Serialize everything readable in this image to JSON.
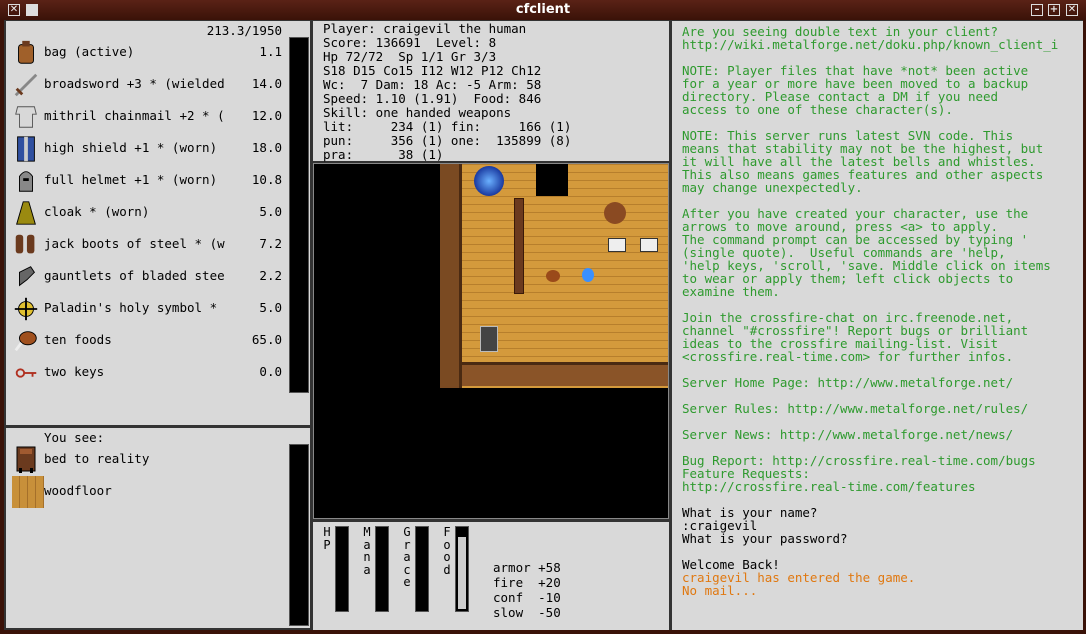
{
  "window": {
    "title": "cfclient"
  },
  "inventory": {
    "weight": "213.3/1950",
    "items": [
      {
        "icon": "bag-icon",
        "name": "bag (active)",
        "weight": "1.1"
      },
      {
        "icon": "sword-icon",
        "name": "broadsword +3 * (wielded",
        "weight": "14.0"
      },
      {
        "icon": "chainmail-icon",
        "name": "mithril chainmail +2 * (",
        "weight": "12.0"
      },
      {
        "icon": "shield-icon",
        "name": "high shield +1 * (worn)",
        "weight": "18.0"
      },
      {
        "icon": "helmet-icon",
        "name": "full helmet +1 * (worn)",
        "weight": "10.8"
      },
      {
        "icon": "cloak-icon",
        "name": "cloak * (worn)",
        "weight": "5.0"
      },
      {
        "icon": "boots-icon",
        "name": "jack boots of steel * (w",
        "weight": "7.2"
      },
      {
        "icon": "gauntlets-icon",
        "name": "gauntlets of bladed stee",
        "weight": "2.2"
      },
      {
        "icon": "holy-symbol-icon",
        "name": "Paladin's holy symbol *",
        "weight": "5.0"
      },
      {
        "icon": "food-icon",
        "name": "ten foods",
        "weight": "65.0"
      },
      {
        "icon": "key-icon",
        "name": "two keys",
        "weight": "0.0"
      }
    ]
  },
  "look": {
    "header": "You see:",
    "items": [
      {
        "icon": "bed-icon",
        "name": "bed to reality"
      },
      {
        "icon": "floor-icon",
        "name": "woodfloor"
      }
    ]
  },
  "stats": {
    "lines": [
      "Player: craigevil the human",
      "Score: 136691  Level: 8",
      "Hp 72/72  Sp 1/1 Gr 3/3",
      "S18 D15 Co15 I12 W12 P12 Ch12",
      "Wc:  7 Dam: 18 Ac: -5 Arm: 58",
      "Speed: 1.10 (1.91)  Food: 846",
      "Skill: one handed weapons",
      "lit:     234 (1) fin:     166 (1)",
      "pun:     356 (1) one:  135899 (8)",
      "pra:      38 (1)"
    ]
  },
  "vitals": {
    "labels": [
      "HP",
      "Mana",
      "Grace",
      "Food"
    ],
    "fill": [
      0,
      0,
      0,
      0.9
    ]
  },
  "resistances": [
    "armor +58",
    "fire  +20",
    "conf  -10",
    "slow  -50"
  ],
  "messages": [
    {
      "t": "Are you seeing double text in your client?",
      "c": "green"
    },
    {
      "t": "http://wiki.metalforge.net/doku.php/known_client_i",
      "c": "green"
    },
    {
      "t": "",
      "c": "green"
    },
    {
      "t": "NOTE: Player files that have *not* been active",
      "c": "green"
    },
    {
      "t": "for a year or more have been moved to a backup",
      "c": "green"
    },
    {
      "t": "directory. Please contact a DM if you need",
      "c": "green"
    },
    {
      "t": "access to one of these character(s).",
      "c": "green"
    },
    {
      "t": "",
      "c": "green"
    },
    {
      "t": "NOTE: This server runs latest SVN code. This",
      "c": "green"
    },
    {
      "t": "means that stability may not be the highest, but",
      "c": "green"
    },
    {
      "t": "it will have all the latest bells and whistles.",
      "c": "green"
    },
    {
      "t": "This also means games features and other aspects",
      "c": "green"
    },
    {
      "t": "may change unexpectedly.",
      "c": "green"
    },
    {
      "t": "",
      "c": "green"
    },
    {
      "t": "After you have created your character, use the",
      "c": "green"
    },
    {
      "t": "arrows to move around, press <a> to apply.",
      "c": "green"
    },
    {
      "t": "The command prompt can be accessed by typing '",
      "c": "green"
    },
    {
      "t": "(single quote).  Useful commands are 'help,",
      "c": "green"
    },
    {
      "t": "'help keys, 'scroll, 'save. Middle click on items",
      "c": "green"
    },
    {
      "t": "to wear or apply them; left click objects to",
      "c": "green"
    },
    {
      "t": "examine them.",
      "c": "green"
    },
    {
      "t": "",
      "c": "green"
    },
    {
      "t": "Join the crossfire-chat on irc.freenode.net,",
      "c": "green"
    },
    {
      "t": "channel \"#crossfire\"! Report bugs or brilliant",
      "c": "green"
    },
    {
      "t": "ideas to the crossfire mailing-list. Visit",
      "c": "green"
    },
    {
      "t": "<crossfire.real-time.com> for further infos.",
      "c": "green"
    },
    {
      "t": "",
      "c": "green"
    },
    {
      "t": "Server Home Page: http://www.metalforge.net/",
      "c": "green"
    },
    {
      "t": "",
      "c": "green"
    },
    {
      "t": "Server Rules: http://www.metalforge.net/rules/",
      "c": "green"
    },
    {
      "t": "",
      "c": "green"
    },
    {
      "t": "Server News: http://www.metalforge.net/news/",
      "c": "green"
    },
    {
      "t": "",
      "c": "green"
    },
    {
      "t": "Bug Report: http://crossfire.real-time.com/bugs",
      "c": "green"
    },
    {
      "t": "Feature Requests:",
      "c": "green"
    },
    {
      "t": "http://crossfire.real-time.com/features",
      "c": "green"
    },
    {
      "t": "",
      "c": "green"
    },
    {
      "t": "What is your name?",
      "c": "black"
    },
    {
      "t": ":craigevil",
      "c": "black"
    },
    {
      "t": "What is your password?",
      "c": "black"
    },
    {
      "t": "",
      "c": "black"
    },
    {
      "t": "Welcome Back!",
      "c": "black"
    },
    {
      "t": "craigevil has entered the game.",
      "c": "orange"
    },
    {
      "t": "No mail...",
      "c": "orange"
    }
  ]
}
